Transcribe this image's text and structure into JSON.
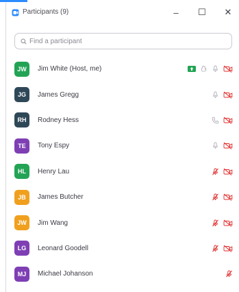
{
  "window": {
    "title": "Participants (9)",
    "minimize_glyph": "–",
    "maximize_glyph": "☐",
    "close_glyph": "✕"
  },
  "search": {
    "placeholder": "Find a participant",
    "value": ""
  },
  "colors": {
    "accent": "#2d8cff",
    "muted_red": "#e02828",
    "icon_gray": "#b0b0b8",
    "share_green": "#23a455"
  },
  "participants": [
    {
      "initials": "JW",
      "name": "Jim White (Host, me)",
      "color": "#23a455",
      "icons": [
        "share-screen-icon",
        "raise-hand-icon",
        "microphone-icon",
        "video-off-icon"
      ]
    },
    {
      "initials": "JG",
      "name": "James Gregg",
      "color": "#2f4858",
      "icons": [
        "microphone-icon",
        "video-off-icon"
      ]
    },
    {
      "initials": "RH",
      "name": "Rodney Hess",
      "color": "#2f4858",
      "icons": [
        "phone-icon",
        "video-off-icon"
      ]
    },
    {
      "initials": "TE",
      "name": "Tony Espy",
      "color": "#7e3fb4",
      "icons": [
        "microphone-icon",
        "video-off-icon"
      ]
    },
    {
      "initials": "HL",
      "name": "Henry Lau",
      "color": "#23a455",
      "icons": [
        "microphone-muted-icon",
        "video-off-icon"
      ]
    },
    {
      "initials": "JB",
      "name": "James Butcher",
      "color": "#f0a01e",
      "icons": [
        "microphone-muted-icon",
        "video-off-icon"
      ]
    },
    {
      "initials": "JW",
      "name": "Jim Wang",
      "color": "#f0a01e",
      "icons": [
        "microphone-muted-icon",
        "video-off-icon"
      ]
    },
    {
      "initials": "LG",
      "name": "Leonard Goodell",
      "color": "#7e3fb4",
      "icons": [
        "microphone-muted-icon",
        "video-off-icon"
      ]
    },
    {
      "initials": "MJ",
      "name": "Michael Johanson",
      "color": "#7e3fb4",
      "icons": [
        "microphone-muted-icon"
      ]
    }
  ]
}
